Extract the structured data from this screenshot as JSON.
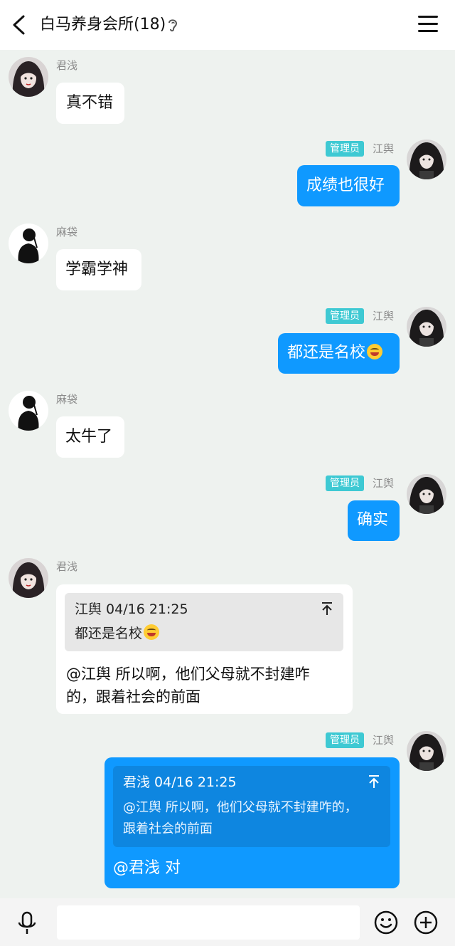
{
  "header": {
    "title": "白马养身会所(18)",
    "back_icon": "chevron-left-icon",
    "ear_icon": "ear-icon",
    "menu_icon": "hamburger-menu-icon"
  },
  "colors": {
    "background": "#eef2ef",
    "outgoing_bubble": "#0f99ff",
    "incoming_bubble": "#ffffff",
    "admin_badge": "#3ec9d3"
  },
  "messages": [
    {
      "sender": "君浅",
      "direction": "in",
      "text": "真不错"
    },
    {
      "sender": "江舆",
      "badge": "管理员",
      "direction": "out",
      "text": "成绩也很好"
    },
    {
      "sender": "麻袋",
      "direction": "in",
      "text": "学霸学神"
    },
    {
      "sender": "江舆",
      "badge": "管理员",
      "direction": "out",
      "text": "都还是名校",
      "emoji": "grinning-squint-emoji"
    },
    {
      "sender": "麻袋",
      "direction": "in",
      "text": "太牛了"
    },
    {
      "sender": "江舆",
      "badge": "管理员",
      "direction": "out",
      "text": "确实"
    },
    {
      "sender": "君浅",
      "direction": "in",
      "quote": {
        "header": "江舆 04/16 21:25",
        "text": "都还是名校",
        "emoji": "grinning-squint-emoji"
      },
      "text_line1": "@江舆 所以啊，他们父母就不封建咋",
      "text_line2": "的，跟着社会的前面"
    },
    {
      "sender": "江舆",
      "badge": "管理员",
      "direction": "out",
      "quote": {
        "header": "君浅 04/16 21:25",
        "text_line1": "@江舆 所以啊，他们父母就不封建咋的，",
        "text_line2": "跟着社会的前面"
      },
      "text": "@君浅 对"
    }
  ],
  "input_bar": {
    "placeholder": "",
    "mic_icon": "microphone-icon",
    "emoji_icon": "smiley-icon",
    "plus_icon": "plus-circle-icon"
  }
}
